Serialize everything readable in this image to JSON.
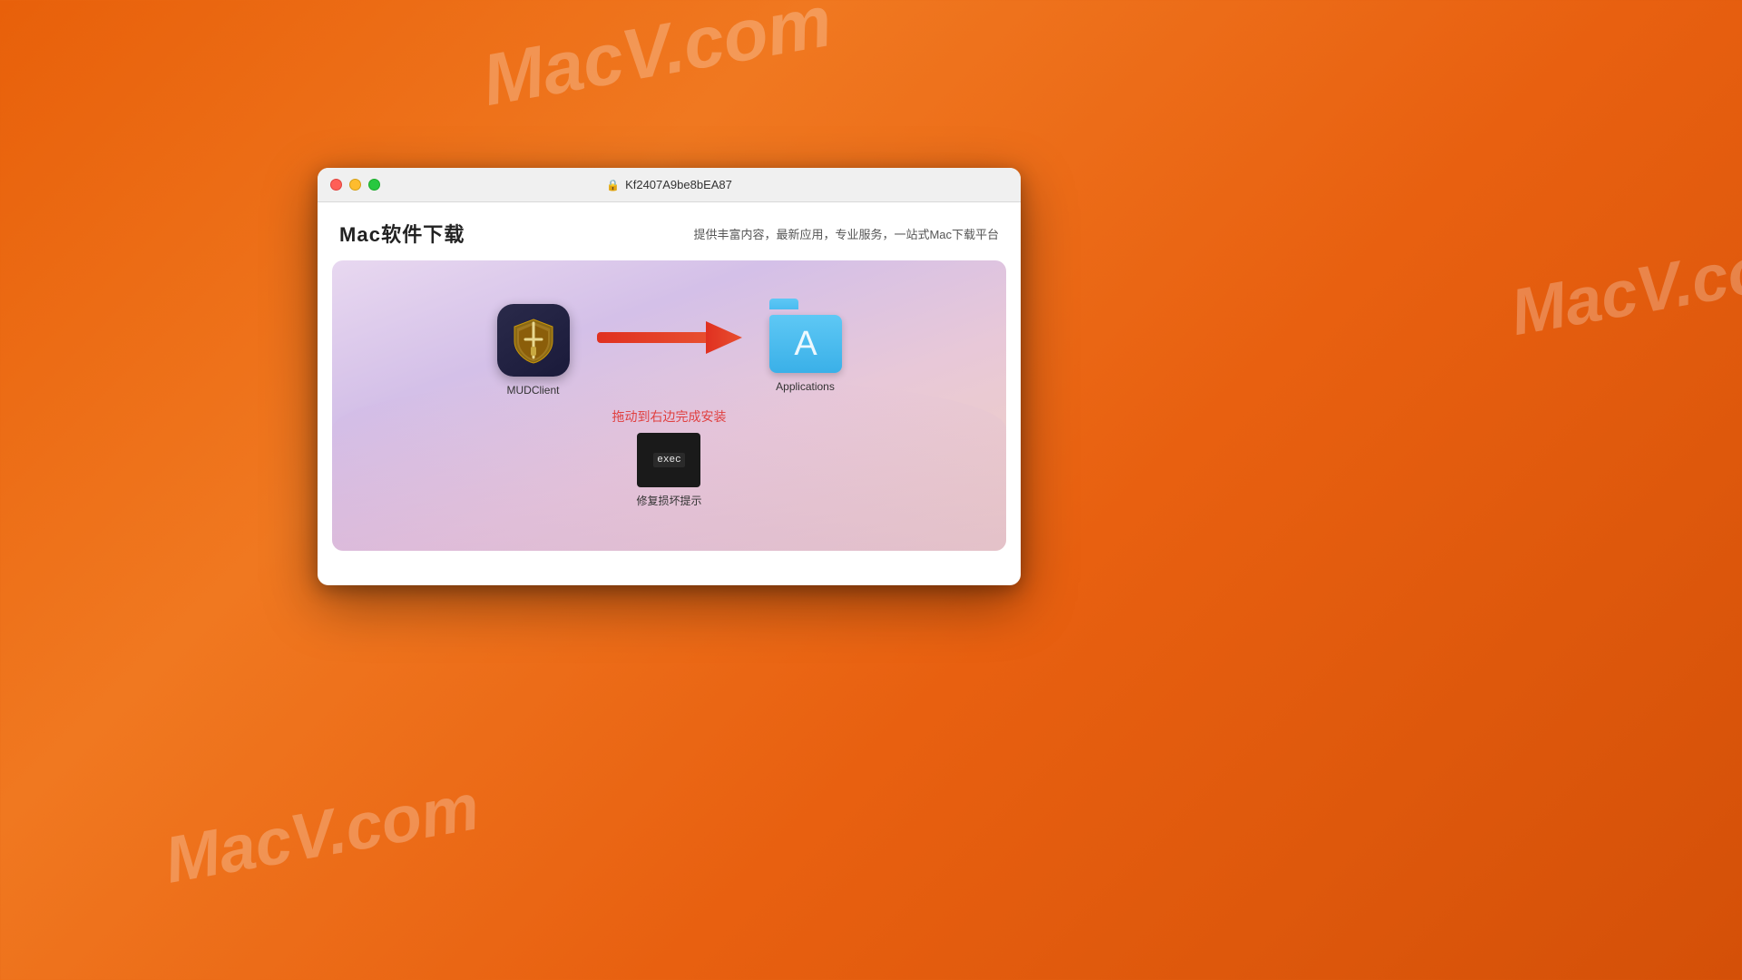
{
  "background": {
    "color": "#e8660a"
  },
  "watermarks": [
    {
      "text": "MacV.com",
      "position": "top-center"
    },
    {
      "text": "MacV.co",
      "position": "right-middle"
    },
    {
      "text": "MacV.com",
      "position": "bottom-left"
    }
  ],
  "window": {
    "title": "Kf2407A9be8bEA87",
    "title_icon": "🔒",
    "traffic_lights": {
      "close": "close",
      "minimize": "minimize",
      "maximize": "maximize"
    },
    "header": {
      "brand": "Mac软件下载",
      "subtitle": "提供丰富内容，最新应用，专业服务，一站式Mac下载平台"
    },
    "dmg": {
      "app_name": "MUDClient",
      "drag_instruction": "拖动到右边完成安装",
      "target_label": "Applications",
      "exec_label": "exec",
      "exec_description": "修复损坏提示"
    }
  }
}
